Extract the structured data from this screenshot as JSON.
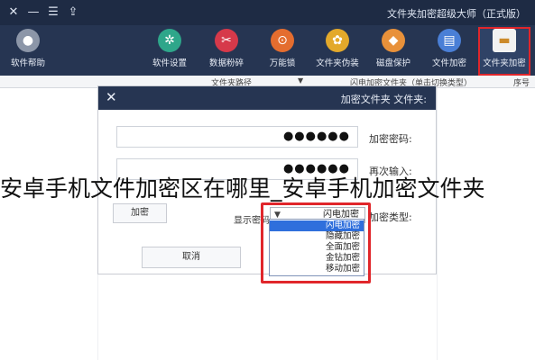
{
  "window": {
    "title": "文件夹加密超级大师（正式版）",
    "controls": {
      "close": "✕",
      "minimize": "—",
      "menu": "☰",
      "share": "⇪"
    }
  },
  "toolbar": {
    "items": [
      {
        "label": "文件夹加密",
        "icon": "folder-icon",
        "glyph": "▬",
        "color": "#f2f2f2",
        "active": true
      },
      {
        "label": "文件加密",
        "icon": "document-icon",
        "glyph": "▤",
        "color": "#4a7fd6"
      },
      {
        "label": "磁盘保护",
        "icon": "shield-icon",
        "glyph": "◆",
        "color": "#e8913a"
      },
      {
        "label": "文件夹伪装",
        "icon": "disguise-icon",
        "glyph": "✿",
        "color": "#e3a92b"
      },
      {
        "label": "万能锁",
        "icon": "lock-icon",
        "glyph": "⊙",
        "color": "#e46d2f"
      },
      {
        "label": "数据粉碎",
        "icon": "scissors-icon",
        "glyph": "✂",
        "color": "#d6394a"
      },
      {
        "label": "软件设置",
        "icon": "gear-icon",
        "glyph": "✲",
        "color": "#2ea68a"
      },
      {
        "label": "软件帮助",
        "icon": "user-icon",
        "glyph": "●",
        "color": "#8c96a8"
      }
    ]
  },
  "columns": {
    "index": "序号",
    "name": "闪电加密文件夹（单击切换类型）",
    "path": "文件夹路径"
  },
  "dialog": {
    "title": "加密文件夹 文件夹:",
    "password_label": "加密密码:",
    "password_value": "●●●●●●",
    "confirm_label": "再次输入:",
    "confirm_value": "●●●●●●",
    "type_label": "加密类型:",
    "type_value": "闪电加密",
    "show_password_label": "显示密码",
    "ok_button": "加密",
    "cancel_button": "取消",
    "type_options": [
      "闪电加密",
      "隐藏加密",
      "全面加密",
      "金钻加密",
      "移动加密"
    ],
    "selected_type_index": 0
  },
  "caption": "安卓手机文件加密区在哪里_安卓手机加密文件夹",
  "colors": {
    "titlebar": "#1e2b44",
    "toolbar": "#263552",
    "highlight": "#e0262b",
    "selection": "#2f6fdc"
  }
}
